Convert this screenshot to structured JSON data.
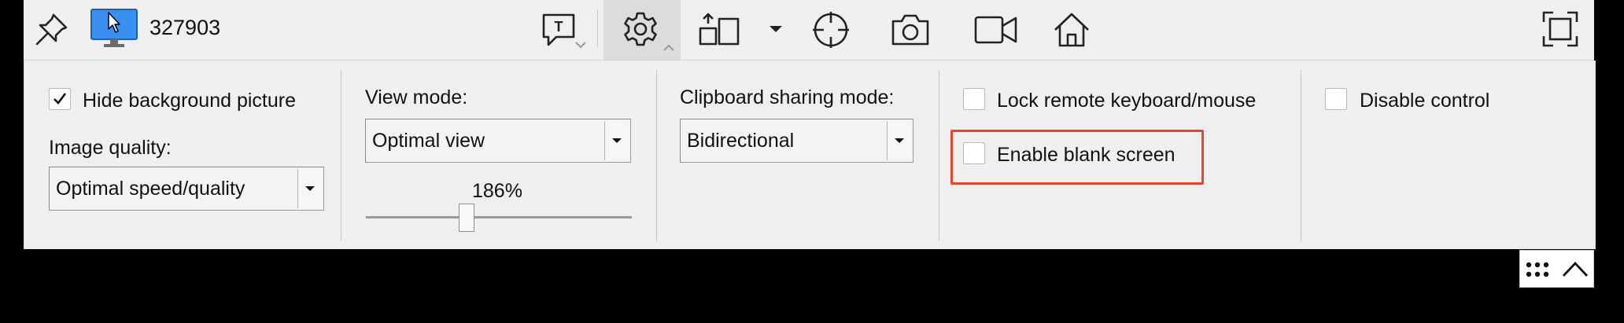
{
  "toolbar": {
    "connection_id": "327903",
    "icons": [
      "pin-icon",
      "remote-monitor-icon",
      "chat-icon",
      "settings-gear-icon",
      "display-layout-icon",
      "dropdown-triangle-icon",
      "crosshair-target-icon",
      "camera-icon",
      "video-icon",
      "home-icon",
      "fullscreen-icon"
    ]
  },
  "settings": {
    "hide_background": {
      "label": "Hide background picture",
      "checked": true
    },
    "image_quality": {
      "label": "Image quality:",
      "value": "Optimal speed/quality"
    },
    "view_mode": {
      "label": "View mode:",
      "value": "Optimal view",
      "zoom": "186%",
      "zoom_fraction": 0.37
    },
    "clipboard": {
      "label": "Clipboard sharing mode:",
      "value": "Bidirectional"
    },
    "lock_keyboard": {
      "label": "Lock remote keyboard/mouse",
      "checked": false
    },
    "blank_screen": {
      "label": "Enable blank screen",
      "checked": false,
      "highlight_color": "#e8432c"
    },
    "disable_control": {
      "label": "Disable control",
      "checked": false
    }
  },
  "colors": {
    "background": "#000000",
    "panel": "#efefef",
    "monitor_accent": "#3b8ff0"
  }
}
